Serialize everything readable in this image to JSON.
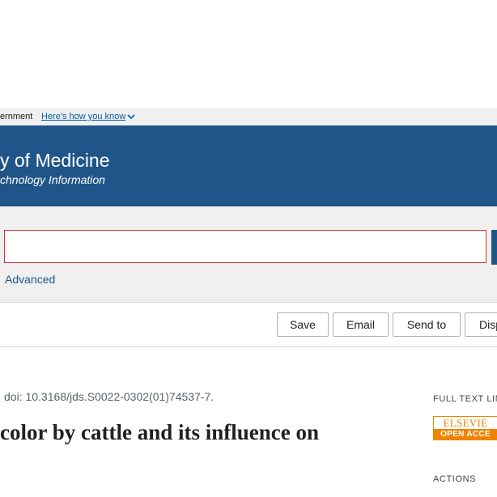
{
  "gov_banner": {
    "text": "ernment",
    "link_text": "Here's how you know"
  },
  "header": {
    "title": "y of Medicine",
    "subtitle": "chnology Information"
  },
  "search": {
    "value": "",
    "advanced_label": "Advanced"
  },
  "toolbar": {
    "save_label": "Save",
    "email_label": "Email",
    "send_to_label": "Send to",
    "display_label": "Disp"
  },
  "article": {
    "doi": "doi: 10.3168/jds.S0022-0302(01)74537-7.",
    "title": "color by cattle and its influence on"
  },
  "sidebar": {
    "full_text_heading": "FULL TEXT LIN",
    "elsevier_brand": "ELSEVIE",
    "open_access": "OPEN ACCE",
    "actions_heading": "ACTIONS"
  },
  "colors": {
    "header_bg": "#20558a",
    "link": "#005ea2",
    "elsevier_orange": "#f08300",
    "search_border": "#d63030"
  }
}
